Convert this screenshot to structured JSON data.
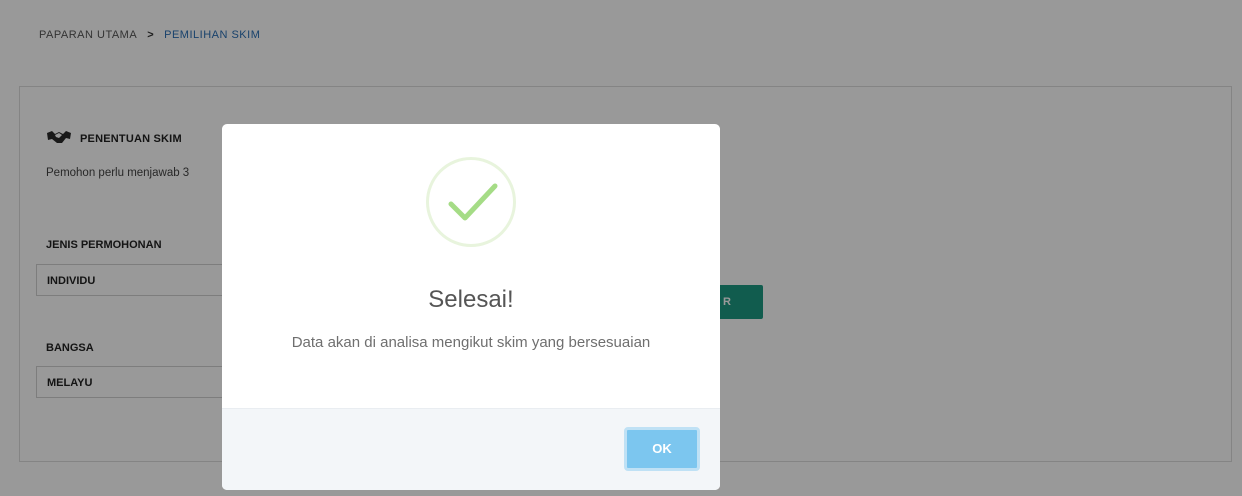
{
  "breadcrumb": {
    "home": "PAPARAN UTAMA",
    "separator": ">",
    "current": "PEMILIHAN SKIM"
  },
  "section": {
    "title": "PENENTUAN SKIM",
    "icon": "handshake-icon",
    "description": "Pemohon perlu menjawab 3"
  },
  "fields": {
    "application_type": {
      "label": "JENIS PERMOHONAN",
      "value": "INDIVIDU"
    },
    "race": {
      "label": "BANGSA",
      "value": "MELAYU"
    }
  },
  "next_button": {
    "label": "R"
  },
  "modal": {
    "icon": "check-icon",
    "title": "Selesai!",
    "text": "Data akan di analisa mengikut skim yang bersesuaian",
    "ok_label": "OK"
  },
  "colors": {
    "accent": "#2a6fb5",
    "button_green": "#1d9a82",
    "check_green": "#a5dc86",
    "ok_blue": "#7cc6ef"
  }
}
